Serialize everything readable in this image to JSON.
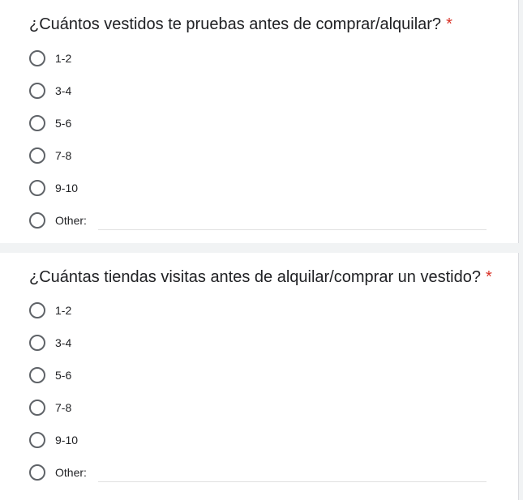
{
  "questions": [
    {
      "title": "¿Cuántos vestidos te pruebas antes de comprar/alquilar?",
      "required_marker": "*",
      "options": [
        "1-2",
        "3-4",
        "5-6",
        "7-8",
        "9-10",
        "Other:"
      ]
    },
    {
      "title": "¿Cuántas tiendas visitas antes de alquilar/comprar un vestido?",
      "required_marker": "*",
      "options": [
        "1-2",
        "3-4",
        "5-6",
        "7-8",
        "9-10",
        "Other:"
      ]
    }
  ],
  "colors": {
    "required": "#d93025",
    "radio_border": "#5f6368",
    "background": "#f1f3f4",
    "card": "#ffffff"
  }
}
